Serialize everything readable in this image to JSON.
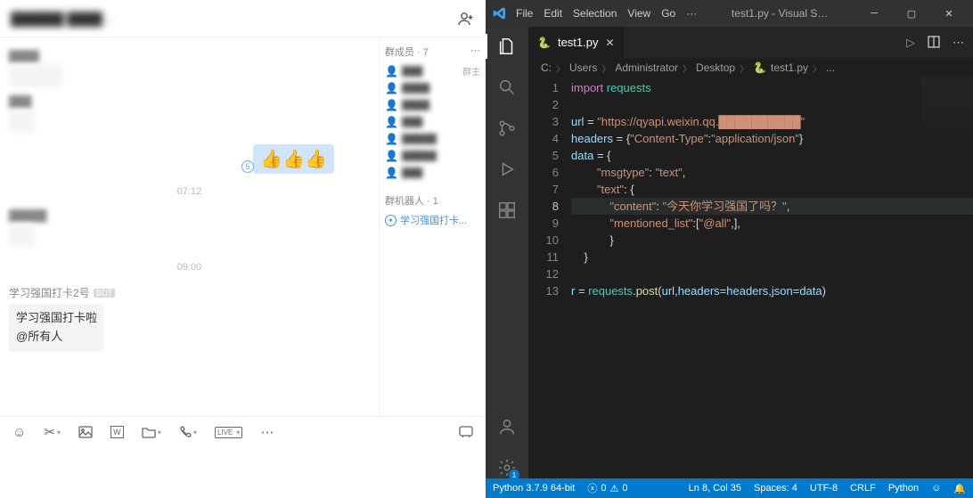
{
  "chat": {
    "header_title": "██████ ████ ··",
    "sidebar": {
      "members_label": "群成员",
      "members_count": "7",
      "owner_label": "群主",
      "robots_label": "群机器人",
      "robots_count": "1",
      "robot_name": "学习强国打卡...",
      "members": [
        {
          "name": "███",
          "role": "群主",
          "cls": "owner"
        },
        {
          "name": "████",
          "role": "",
          "cls": "user"
        },
        {
          "name": "████",
          "role": "",
          "cls": "user"
        },
        {
          "name": "███",
          "role": "",
          "cls": "user"
        },
        {
          "name": "█████",
          "role": "",
          "cls": "user"
        },
        {
          "name": "█████",
          "role": "",
          "cls": "user"
        },
        {
          "name": "███",
          "role": "",
          "cls": "user"
        }
      ]
    },
    "messages": {
      "user1": "████",
      "user3": "█████",
      "read_count": "5",
      "time1": "07:12",
      "time2": "09:00",
      "bot_sender": "学习强国打卡2号",
      "bot_tag": "BOT",
      "bot_line1": "学习强国打卡啦",
      "bot_line2": "@所有人"
    }
  },
  "vscode": {
    "menu": [
      "File",
      "Edit",
      "Selection",
      "View",
      "Go",
      "···"
    ],
    "window_title": "test1.py - Visual S…",
    "tab_name": "test1.py",
    "breadcrumb": [
      "C:",
      "Users",
      "Administrator",
      "Desktop",
      "test1.py",
      "..."
    ],
    "code_lines": [
      {
        "n": "1",
        "html": "<span class='k-import'>import</span> <span class='k-mod'>requests</span>"
      },
      {
        "n": "2",
        "html": ""
      },
      {
        "n": "3",
        "html": "<span class='k-var'>url</span> <span class='k-punc'>=</span> <span class='k-str'>\"https://qyapi.weixin.qq.██████████\"</span>"
      },
      {
        "n": "4",
        "html": "<span class='k-var'>headers</span> <span class='k-punc'>= {</span><span class='k-str'>\"Content-Type\"</span><span class='k-punc'>:</span><span class='k-str'>\"application/json\"</span><span class='k-punc'>}</span>"
      },
      {
        "n": "5",
        "html": "<span class='k-var'>data</span> <span class='k-punc'>= {</span>"
      },
      {
        "n": "6",
        "html": "        <span class='k-str'>\"msgtype\"</span><span class='k-punc'>:</span> <span class='k-str'>\"text\"</span><span class='k-punc'>,</span>"
      },
      {
        "n": "7",
        "html": "        <span class='k-str'>\"text\"</span><span class='k-punc'>: {</span>"
      },
      {
        "n": "8",
        "html": "            <span class='k-str'>\"content\"</span><span class='k-punc'>:</span> <span class='k-str'>\"今天你学习强国了吗？\"</span><span class='k-punc'>,</span>",
        "hl": true
      },
      {
        "n": "9",
        "html": "            <span class='k-str'>\"mentioned_list\"</span><span class='k-punc'>:[</span><span class='k-str'>\"@all\"</span><span class='k-punc'>,],</span>"
      },
      {
        "n": "10",
        "html": "            <span class='k-punc'>}</span>"
      },
      {
        "n": "11",
        "html": "    <span class='k-punc'>}</span>"
      },
      {
        "n": "12",
        "html": ""
      },
      {
        "n": "13",
        "html": "<span class='k-var'>r</span> <span class='k-punc'>=</span> <span class='k-mod'>requests</span><span class='k-punc'>.</span><span class='k-member'>post</span><span class='k-punc'>(</span><span class='k-var'>url</span><span class='k-punc'>,</span><span class='k-var'>headers</span><span class='k-punc'>=</span><span class='k-var'>headers</span><span class='k-punc'>,</span><span class='k-var'>json</span><span class='k-punc'>=</span><span class='k-var'>data</span><span class='k-punc'>)</span>"
      }
    ],
    "status": {
      "python": "Python 3.7.9 64-bit",
      "err": "0",
      "warn": "0",
      "pos": "Ln 8, Col 35",
      "spaces": "Spaces: 4",
      "enc": "UTF-8",
      "eol": "CRLF",
      "lang": "Python",
      "feedback": "☺"
    },
    "settings_badge": "1"
  }
}
